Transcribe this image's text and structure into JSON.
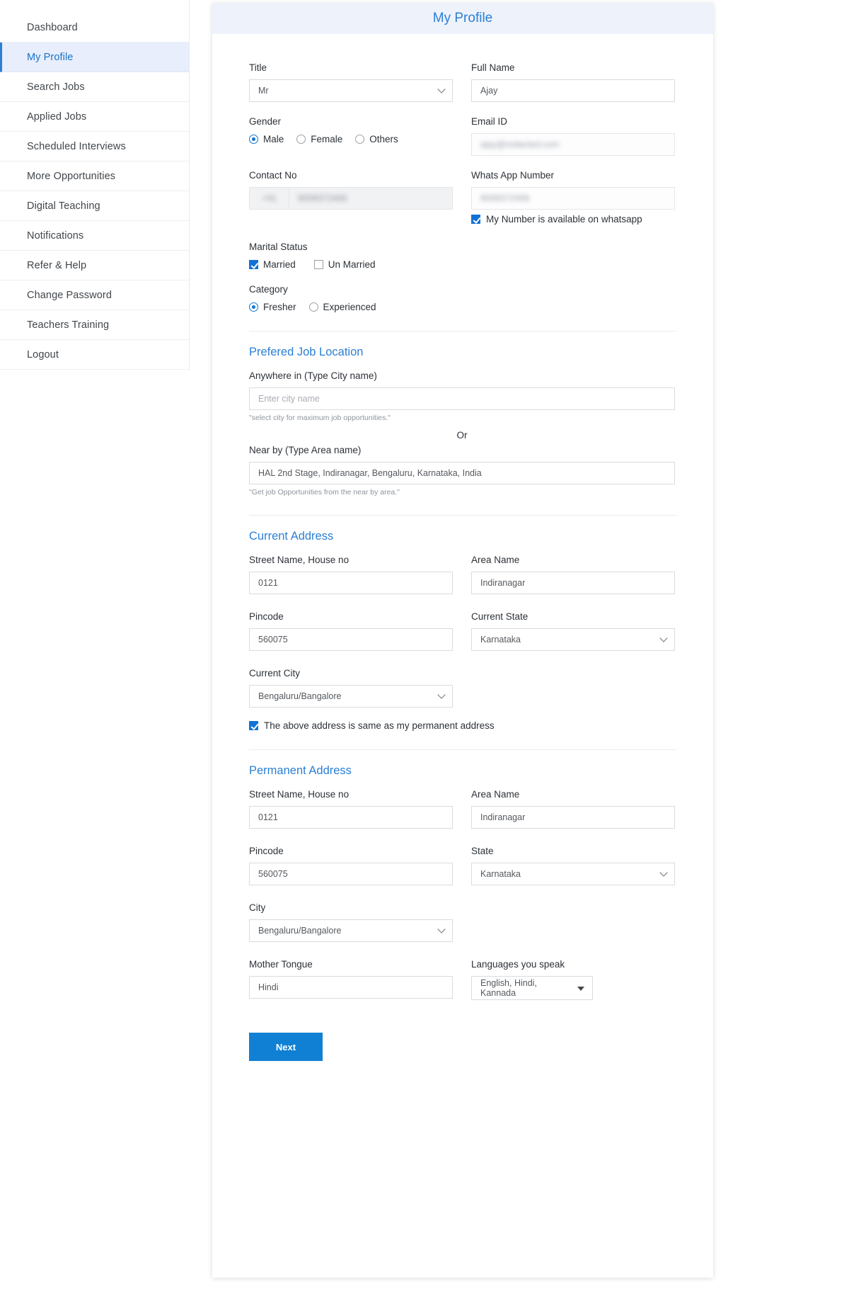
{
  "sidebar": {
    "items": [
      {
        "label": "Dashboard",
        "active": false
      },
      {
        "label": "My Profile",
        "active": true
      },
      {
        "label": "Search Jobs",
        "active": false
      },
      {
        "label": "Applied Jobs",
        "active": false
      },
      {
        "label": "Scheduled Interviews",
        "active": false
      },
      {
        "label": "More Opportunities",
        "active": false
      },
      {
        "label": "Digital Teaching",
        "active": false
      },
      {
        "label": "Notifications",
        "active": false
      },
      {
        "label": "Refer & Help",
        "active": false
      },
      {
        "label": "Change Password",
        "active": false
      },
      {
        "label": "Teachers Training",
        "active": false
      },
      {
        "label": "Logout",
        "active": false
      }
    ]
  },
  "header": {
    "title": "My Profile"
  },
  "form": {
    "title": {
      "label": "Title",
      "value": "Mr"
    },
    "full_name": {
      "label": "Full Name",
      "value": "Ajay"
    },
    "gender": {
      "label": "Gender",
      "options": [
        "Male",
        "Female",
        "Others"
      ],
      "selected": "Male"
    },
    "email": {
      "label": "Email ID",
      "value": "ajay@redacted.com",
      "redacted": true
    },
    "contact_no": {
      "label": "Contact No",
      "country_code": "+91",
      "value": "9008372466",
      "redacted": true
    },
    "whatsapp_number": {
      "label": "Whats App Number",
      "value": "9008372466",
      "redacted": true
    },
    "whatsapp_checkbox": {
      "label": "My Number is available on whatsapp",
      "checked": true
    },
    "marital_status": {
      "label": "Marital Status",
      "options": [
        {
          "label": "Married",
          "checked": true
        },
        {
          "label": "Un Married",
          "checked": false
        }
      ]
    },
    "category": {
      "label": "Category",
      "options": [
        "Fresher",
        "Experienced"
      ],
      "selected": "Fresher"
    }
  },
  "preferred_job_location": {
    "section_title": "Prefered Job Location",
    "city": {
      "label": "Anywhere in (Type City name)",
      "value": "",
      "placeholder": "Enter city name",
      "hint": "\"select city for maximum job opportunities.\""
    },
    "or": "Or",
    "area": {
      "label": "Near by (Type Area name)",
      "value": "HAL 2nd Stage, Indiranagar, Bengaluru, Karnataka, India",
      "hint": "\"Get job Opportunities from the near by area.\""
    }
  },
  "current_address": {
    "section_title": "Current Address",
    "street": {
      "label": "Street Name, House no",
      "value": "0121"
    },
    "area_name": {
      "label": "Area Name",
      "value": "Indiranagar"
    },
    "pincode": {
      "label": "Pincode",
      "value": "560075"
    },
    "state": {
      "label": "Current State",
      "value": "Karnataka"
    },
    "city": {
      "label": "Current City",
      "value": "Bengaluru/Bangalore"
    },
    "same_as_permanent": {
      "label": "The above address is same as my permanent address",
      "checked": true
    }
  },
  "permanent_address": {
    "section_title": "Permanent Address",
    "street": {
      "label": "Street Name, House no",
      "value": "0121"
    },
    "area_name": {
      "label": "Area Name",
      "value": "Indiranagar"
    },
    "pincode": {
      "label": "Pincode",
      "value": "560075"
    },
    "state": {
      "label": "State",
      "value": "Karnataka"
    },
    "city": {
      "label": "City",
      "value": "Bengaluru/Bangalore"
    },
    "mother_tongue": {
      "label": "Mother Tongue",
      "value": "Hindi"
    },
    "languages": {
      "label": "Languages you speak",
      "value": "English, Hindi, Kannada"
    }
  },
  "actions": {
    "next_label": "Next"
  },
  "colors": {
    "accent": "#2b7fd4",
    "button": "#1080d4",
    "active_nav_bg": "#e8eefc"
  }
}
